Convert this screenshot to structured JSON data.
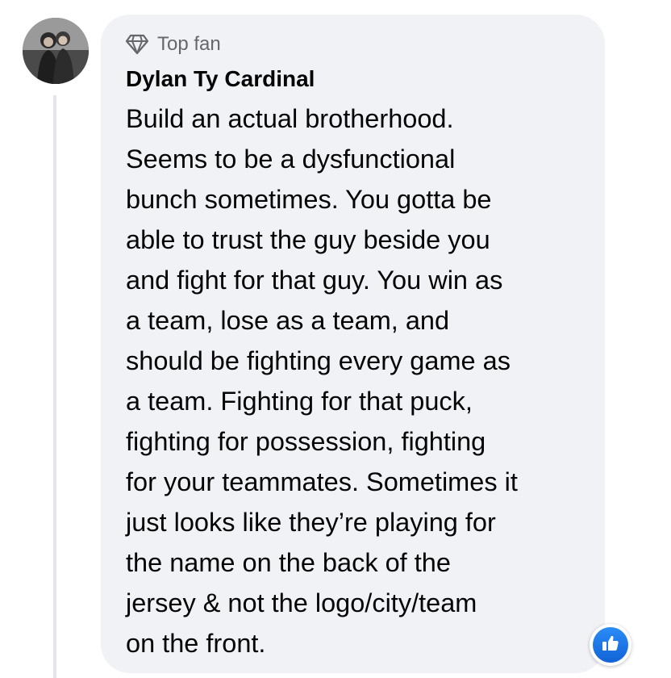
{
  "comment": {
    "badge_label": "Top fan",
    "badge_icon": "diamond-icon",
    "author_name": "Dylan Ty Cardinal",
    "text": "Build an actual brotherhood.\nSeems to be a dysfunctional\nbunch sometimes. You gotta be\nable to trust the guy beside you\nand fight for that guy. You win as\na team, lose as a team, and\nshould be fighting every game as\na team. Fighting for that puck,\nfighting for possession, fighting\nfor your teammates. Sometimes it\njust looks like they’re playing for\nthe name on the back of the\njersey & not the logo/city/team\non the front.",
    "reaction_icon": "like-icon"
  },
  "colors": {
    "bubble": "#f0f2f5",
    "secondary_text": "#65676b",
    "primary_text": "#050505",
    "like_blue": "#1877f2"
  }
}
